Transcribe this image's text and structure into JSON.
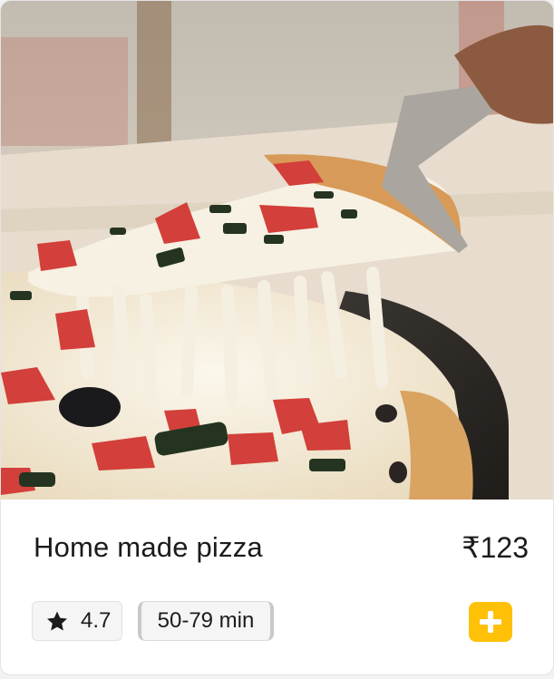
{
  "product": {
    "image_alt": "Pizza slice being lifted with stretching cheese",
    "title": "Home made pizza",
    "price": "₹123",
    "rating": "4.7",
    "delivery_time": "50-79 min"
  },
  "icons": {
    "rating": "star-icon",
    "add": "plus-icon"
  },
  "colors": {
    "accent": "#ffc107",
    "badge_background": "#f5f5f6",
    "text": "#1b1b1b"
  }
}
